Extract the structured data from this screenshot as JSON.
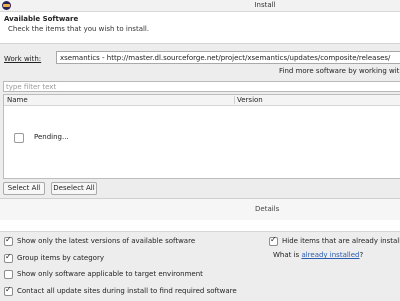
{
  "window": {
    "title": "Install"
  },
  "header": {
    "title": "Available Software",
    "message": "Check the items that you wish to install."
  },
  "work_with": {
    "label": "Work with:",
    "value": "xsemantics - http://master.dl.sourceforge.net/project/xsemantics/updates/composite/releases/",
    "find_more": "Find more software by working with the"
  },
  "filter": {
    "placeholder": "type filter text"
  },
  "table": {
    "columns": [
      "Name",
      "Version"
    ],
    "rows": [
      {
        "name": "Pending...",
        "version": ""
      }
    ]
  },
  "buttons": {
    "select_all": "Select All",
    "deselect_all": "Deselect All"
  },
  "details": {
    "label": "Details"
  },
  "options": {
    "latest": {
      "label": "Show only the latest versions of available software",
      "checked": true
    },
    "group": {
      "label": "Group items by category",
      "checked": true
    },
    "applicable": {
      "label": "Show only software applicable to target environment",
      "checked": false
    },
    "contact": {
      "label": "Contact all update sites during install to find required software",
      "checked": true
    },
    "hide_installed": {
      "label": "Hide items that are already installed",
      "checked": true
    },
    "what_is": {
      "prefix": "What is ",
      "link": "already installed",
      "suffix": "?"
    }
  }
}
